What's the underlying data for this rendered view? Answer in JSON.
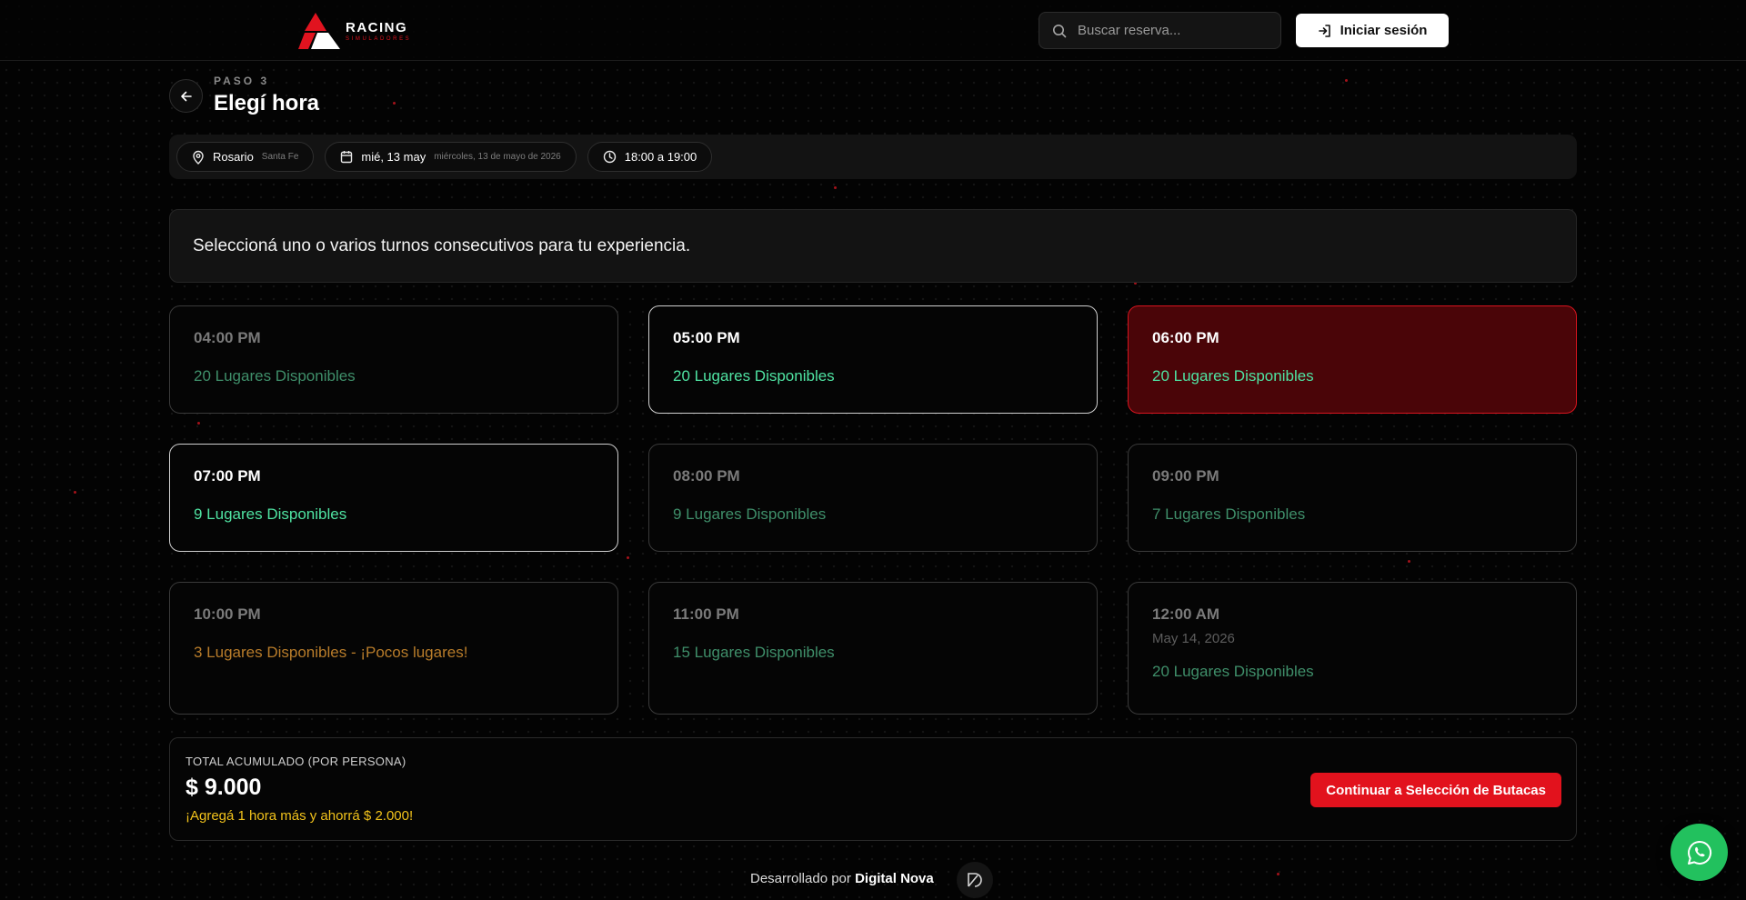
{
  "brand": {
    "name": "RACING",
    "tagline": "SIMULADORES",
    "accent": "#e1131f"
  },
  "header": {
    "search_placeholder": "Buscar reserva...",
    "login_label": "Iniciar sesión"
  },
  "step": {
    "label": "PASO 3",
    "title": "Elegí hora"
  },
  "summary": {
    "location": "Rosario",
    "province": "Santa Fe",
    "date_short": "mié, 13 may",
    "date_long": "miércoles, 13 de mayo de 2026",
    "time_range": "18:00 a 19:00"
  },
  "notice": "Seleccioná uno o varios turnos consecutivos para tu experiencia.",
  "slots": [
    {
      "time": "04:00 PM",
      "availability": "20 Lugares Disponibles",
      "state": "disabled"
    },
    {
      "time": "05:00 PM",
      "availability": "20 Lugares Disponibles",
      "state": "active"
    },
    {
      "time": "06:00 PM",
      "availability": "20 Lugares Disponibles",
      "state": "selected"
    },
    {
      "time": "07:00 PM",
      "availability": "9 Lugares Disponibles",
      "state": "active"
    },
    {
      "time": "08:00 PM",
      "availability": "9 Lugares Disponibles",
      "state": "disabled"
    },
    {
      "time": "09:00 PM",
      "availability": "7 Lugares Disponibles",
      "state": "disabled"
    },
    {
      "time": "10:00 PM",
      "availability": "3 Lugares Disponibles - ¡Pocos lugares!",
      "state": "disabled"
    },
    {
      "time": "11:00 PM",
      "availability": "15 Lugares Disponibles",
      "state": "disabled"
    },
    {
      "time": "12:00 AM",
      "date": "May 14, 2026",
      "availability": "20 Lugares Disponibles",
      "state": "disabled"
    }
  ],
  "footer": {
    "total_label": "TOTAL ACUMULADO (POR PERSONA)",
    "total_value": "$ 9.000",
    "promo": "¡Agregá 1 hora más y ahorrá $ 2.000!",
    "continue_label": "Continuar a Selección de Butacas"
  },
  "credit": {
    "prefix": "Desarrollado por",
    "company": "Digital Nova"
  },
  "colors": {
    "selected_bg": "#4a0508",
    "selected_border": "#d8141e",
    "available_green": "#4fe3a2",
    "low_orange": "#b87c2a",
    "promo_yellow": "#f1c21b",
    "whatsapp_green": "#22c15e"
  }
}
